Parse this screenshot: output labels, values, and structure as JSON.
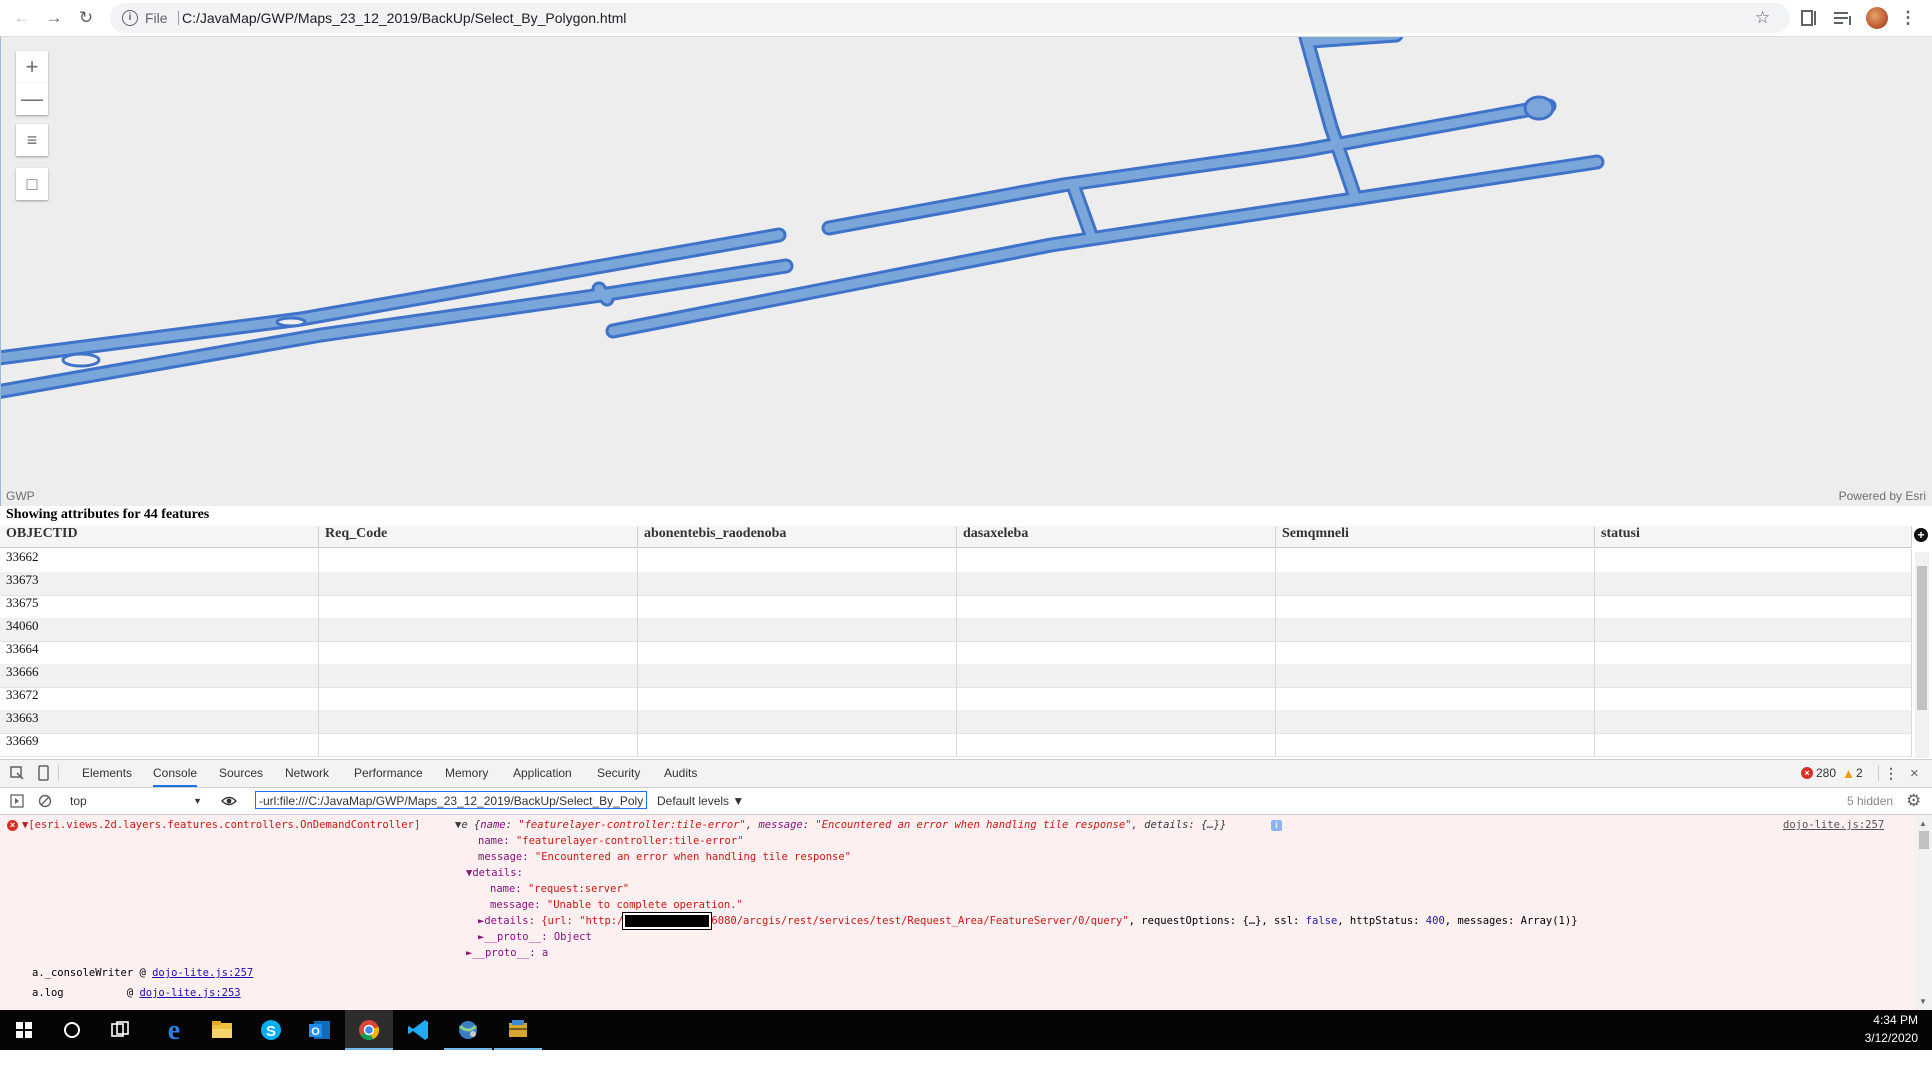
{
  "browser": {
    "scheme": "File",
    "url": "C:/JavaMap/GWP/Maps_23_12_2019/BackUp/Select_By_Polygon.html"
  },
  "map": {
    "controls": [
      "+",
      "—",
      "≡",
      "□"
    ],
    "attribution_left": "GWP",
    "attribution_right": "Powered by Esri",
    "feature_color": "#7aa6da",
    "feature_outline": "#3f72c9"
  },
  "table": {
    "title": "Showing attributes for 44 features",
    "columns": [
      "OBJECTID",
      "Req_Code",
      "abonentebis_raodenoba",
      "dasaxeleba",
      "Semqmneli",
      "statusi"
    ],
    "rows": [
      "33662",
      "33673",
      "33675",
      "34060",
      "33664",
      "33666",
      "33672",
      "33663",
      "33669"
    ]
  },
  "devtools": {
    "tabs": [
      "Elements",
      "Console",
      "Sources",
      "Network",
      "Performance",
      "Memory",
      "Application",
      "Security",
      "Audits"
    ],
    "active_tab": "Console",
    "errors": "280",
    "warnings": "2",
    "context": "top",
    "filter": "-url:file:///C:/JavaMap/GWP/Maps_23_12_2019/BackUp/Select_By_Poly",
    "levels": "Default levels ▼",
    "hidden": "5 hidden",
    "source": "dojo-lite.js:257",
    "log": {
      "origin": "[esri.views.2d.layers.features.controllers.OnDemandController]",
      "summary_open": "▼e {",
      "name_key": "name",
      "name_val": "\"featurelayer-controller:tile-error\"",
      "message_key": "message",
      "message_val": "\"Encountered an error when handling tile response\"",
      "summary_tail": "details: {…}}",
      "line1_key": "name:",
      "line1_val": "\"featurelayer-controller:tile-error\"",
      "line2_key": "message:",
      "line2_val": "\"Encountered an error when handling tile response\"",
      "line3": "▼details:",
      "line4_key": "name:",
      "line4_val": "\"request:server\"",
      "line5_key": "message:",
      "line5_val": "\"Unable to complete operation.\"",
      "line6_key": "►details:",
      "line6_url_a": "{url: \"http:/",
      "line6_url_b": "6080/arcgis/rest/services/test/Request_Area/FeatureServer/0/query\"",
      "line6_rest": ", requestOptions: {…}, ssl: ",
      "line6_ssl": "false",
      "line6_status": ", httpStatus: ",
      "line6_code": "400",
      "line6_end": ", messages: Array(1)}",
      "line7": "►__proto__: Object",
      "line8": "►__proto__: a",
      "stack1_fn": "a._consoleWriter @ ",
      "stack1_link": "dojo-lite.js:257",
      "stack2_fn": "a.log          @ ",
      "stack2_link": "dojo-lite.js:253"
    }
  },
  "taskbar": {
    "time": "4:34 PM",
    "date": "3/12/2020"
  }
}
